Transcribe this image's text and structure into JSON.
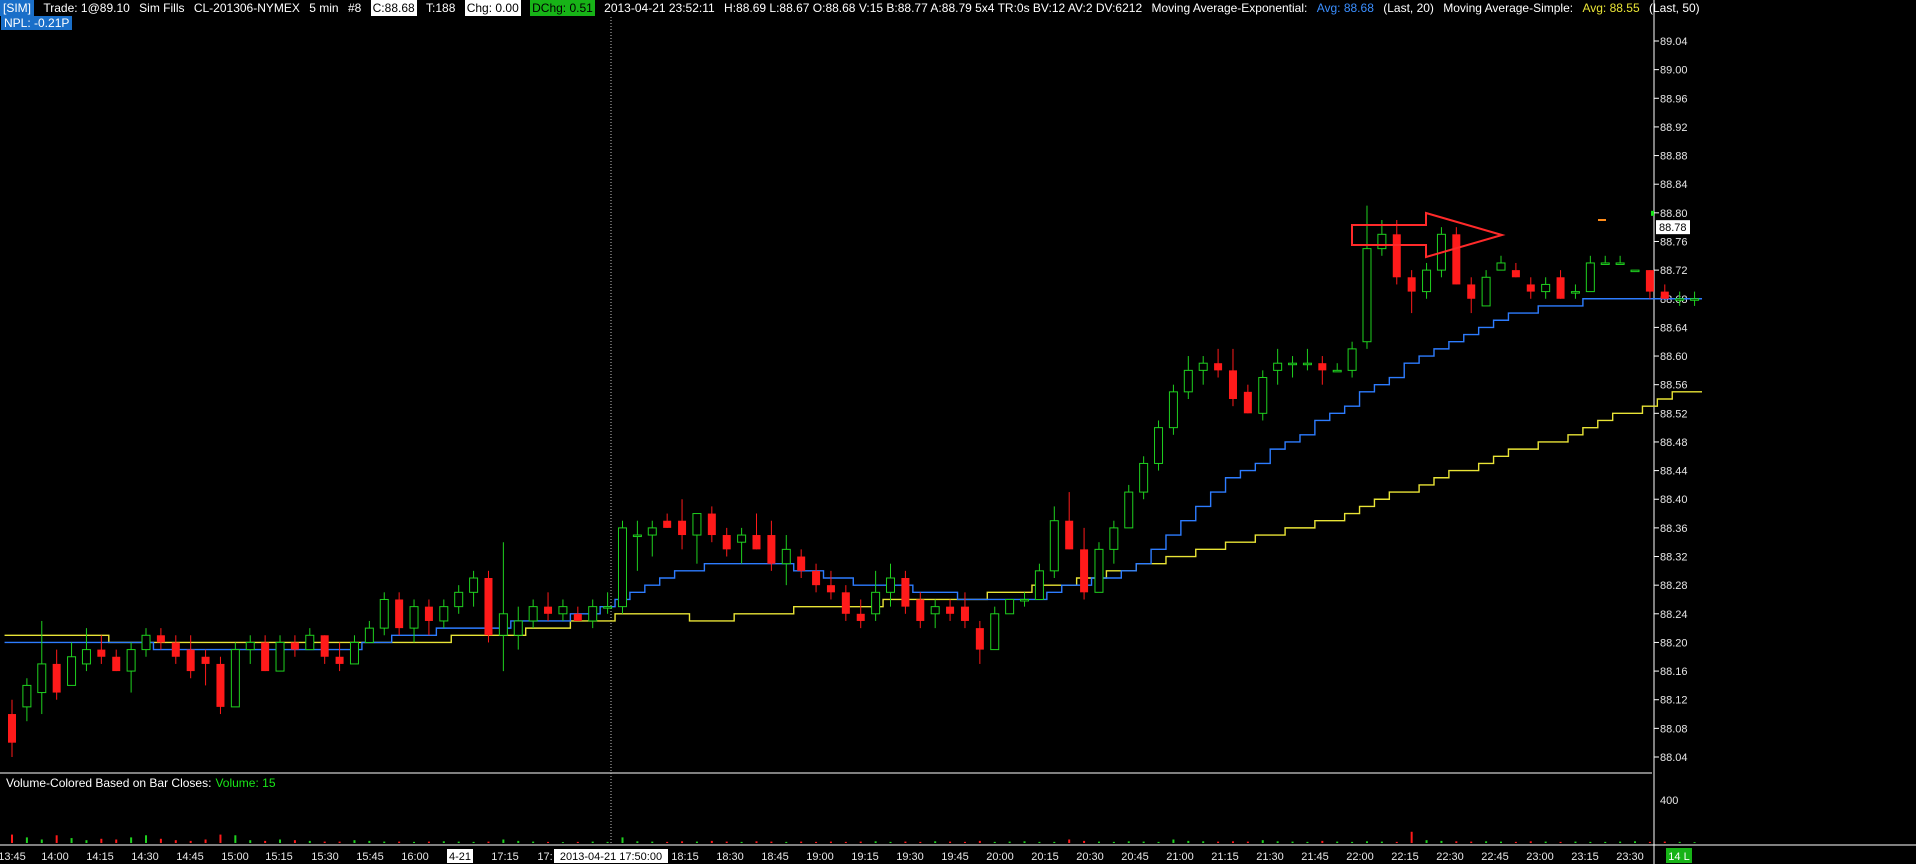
{
  "header": {
    "sim_tag": "[SIM]",
    "trade": "Trade: 1@89.10",
    "sim_fills": "Sim Fills",
    "instrument": "CL-201306-NYMEX",
    "interval": "5 min",
    "hash": "#8",
    "close": "C:88.68",
    "ticks": "T:188",
    "chg": "Chg: 0.00",
    "dchg": "DChg: 0.51",
    "datetime": "2013-04-21 23:52:11",
    "ohlc": "H:88.69 L:88.67 O:88.68 V:15 B:88.77 A:88.79 5x4 TR:0s BV:12 AV:2 DV:6212",
    "ema_label": "Moving Average-Exponential:",
    "ema_avg": "Avg: 88.68",
    "ema_period": "(Last, 20)",
    "sma_label": "Moving Average-Simple:",
    "sma_avg": "Avg: 88.55",
    "sma_period": "(Last, 50)"
  },
  "npl": "NPL: -0.21P",
  "volume_panel": {
    "title": "Volume-Colored Based on Bar Closes:",
    "value": "Volume: 15",
    "axis_label": "400"
  },
  "price_axis": {
    "ticks": [
      "89.04",
      "89.00",
      "88.96",
      "88.92",
      "88.88",
      "88.84",
      "88.80",
      "88.76",
      "88.72",
      "88.68",
      "88.64",
      "88.60",
      "88.56",
      "88.52",
      "88.48",
      "88.44",
      "88.40",
      "88.36",
      "88.32",
      "88.28",
      "88.24",
      "88.20",
      "88.16",
      "88.12",
      "88.08",
      "88.04"
    ],
    "current_price": "88.78"
  },
  "time_axis": {
    "labels": [
      "13:45",
      "14:00",
      "14:15",
      "14:30",
      "14:45",
      "15:00",
      "15:15",
      "15:30",
      "15:45",
      "16:00",
      "4-21",
      "17:15",
      "17:",
      "2013-04-21  17:50:00",
      "18:15",
      "18:30",
      "18:45",
      "19:00",
      "19:15",
      "19:30",
      "19:45",
      "20:00",
      "20:15",
      "20:30",
      "20:45",
      "21:00",
      "21:15",
      "21:30",
      "21:45",
      "22:00",
      "22:15",
      "22:30",
      "22:45",
      "23:00",
      "23:15",
      "23:30"
    ],
    "corner_badge": "14 L"
  },
  "colors": {
    "up": "#1fd11f",
    "down": "#ff1a1a",
    "ema": "#2d7cff",
    "sma": "#e9e436",
    "annotation": "#ff2a2a"
  },
  "chart_data": {
    "type": "candlestick",
    "y_range": [
      88.0,
      89.08
    ],
    "bars": [
      {
        "o": 88.1,
        "h": 88.12,
        "l": 88.04,
        "c": 88.06
      },
      {
        "o": 88.11,
        "h": 88.15,
        "l": 88.09,
        "c": 88.14
      },
      {
        "o": 88.13,
        "h": 88.23,
        "l": 88.1,
        "c": 88.17
      },
      {
        "o": 88.17,
        "h": 88.19,
        "l": 88.12,
        "c": 88.13
      },
      {
        "o": 88.14,
        "h": 88.2,
        "l": 88.14,
        "c": 88.18
      },
      {
        "o": 88.17,
        "h": 88.22,
        "l": 88.16,
        "c": 88.19
      },
      {
        "o": 88.19,
        "h": 88.21,
        "l": 88.17,
        "c": 88.18
      },
      {
        "o": 88.18,
        "h": 88.19,
        "l": 88.16,
        "c": 88.16
      },
      {
        "o": 88.16,
        "h": 88.2,
        "l": 88.13,
        "c": 88.19
      },
      {
        "o": 88.19,
        "h": 88.22,
        "l": 88.18,
        "c": 88.21
      },
      {
        "o": 88.21,
        "h": 88.22,
        "l": 88.19,
        "c": 88.2
      },
      {
        "o": 88.2,
        "h": 88.21,
        "l": 88.17,
        "c": 88.18
      },
      {
        "o": 88.19,
        "h": 88.21,
        "l": 88.15,
        "c": 88.16
      },
      {
        "o": 88.18,
        "h": 88.19,
        "l": 88.14,
        "c": 88.17
      },
      {
        "o": 88.17,
        "h": 88.18,
        "l": 88.1,
        "c": 88.11
      },
      {
        "o": 88.11,
        "h": 88.2,
        "l": 88.11,
        "c": 88.19
      },
      {
        "o": 88.19,
        "h": 88.21,
        "l": 88.17,
        "c": 88.2
      },
      {
        "o": 88.2,
        "h": 88.21,
        "l": 88.16,
        "c": 88.16
      },
      {
        "o": 88.16,
        "h": 88.21,
        "l": 88.16,
        "c": 88.2
      },
      {
        "o": 88.2,
        "h": 88.21,
        "l": 88.18,
        "c": 88.19
      },
      {
        "o": 88.19,
        "h": 88.22,
        "l": 88.19,
        "c": 88.21
      },
      {
        "o": 88.21,
        "h": 88.21,
        "l": 88.17,
        "c": 88.18
      },
      {
        "o": 88.18,
        "h": 88.2,
        "l": 88.16,
        "c": 88.17
      },
      {
        "o": 88.17,
        "h": 88.21,
        "l": 88.17,
        "c": 88.2
      },
      {
        "o": 88.2,
        "h": 88.23,
        "l": 88.2,
        "c": 88.22
      },
      {
        "o": 88.22,
        "h": 88.27,
        "l": 88.21,
        "c": 88.26
      },
      {
        "o": 88.26,
        "h": 88.27,
        "l": 88.21,
        "c": 88.22
      },
      {
        "o": 88.22,
        "h": 88.26,
        "l": 88.2,
        "c": 88.25
      },
      {
        "o": 88.25,
        "h": 88.26,
        "l": 88.21,
        "c": 88.23
      },
      {
        "o": 88.23,
        "h": 88.26,
        "l": 88.22,
        "c": 88.25
      },
      {
        "o": 88.25,
        "h": 88.28,
        "l": 88.24,
        "c": 88.27
      },
      {
        "o": 88.27,
        "h": 88.3,
        "l": 88.25,
        "c": 88.29
      },
      {
        "o": 88.29,
        "h": 88.3,
        "l": 88.2,
        "c": 88.21
      },
      {
        "o": 88.21,
        "h": 88.34,
        "l": 88.16,
        "c": 88.24
      },
      {
        "o": 88.21,
        "h": 88.25,
        "l": 88.19,
        "c": 88.23
      },
      {
        "o": 88.23,
        "h": 88.26,
        "l": 88.22,
        "c": 88.25
      },
      {
        "o": 88.25,
        "h": 88.27,
        "l": 88.23,
        "c": 88.24
      },
      {
        "o": 88.24,
        "h": 88.26,
        "l": 88.23,
        "c": 88.25
      },
      {
        "o": 88.24,
        "h": 88.25,
        "l": 88.23,
        "c": 88.23
      },
      {
        "o": 88.23,
        "h": 88.26,
        "l": 88.22,
        "c": 88.25
      },
      {
        "o": 88.25,
        "h": 88.27,
        "l": 88.24,
        "c": 88.25
      },
      {
        "o": 88.25,
        "h": 88.37,
        "l": 88.24,
        "c": 88.36
      },
      {
        "o": 88.35,
        "h": 88.37,
        "l": 88.3,
        "c": 88.35
      },
      {
        "o": 88.35,
        "h": 88.37,
        "l": 88.32,
        "c": 88.36
      },
      {
        "o": 88.37,
        "h": 88.38,
        "l": 88.36,
        "c": 88.36
      },
      {
        "o": 88.37,
        "h": 88.4,
        "l": 88.33,
        "c": 88.35
      },
      {
        "o": 88.35,
        "h": 88.38,
        "l": 88.31,
        "c": 88.38
      },
      {
        "o": 88.38,
        "h": 88.39,
        "l": 88.34,
        "c": 88.35
      },
      {
        "o": 88.35,
        "h": 88.36,
        "l": 88.32,
        "c": 88.33
      },
      {
        "o": 88.34,
        "h": 88.36,
        "l": 88.31,
        "c": 88.35
      },
      {
        "o": 88.35,
        "h": 88.38,
        "l": 88.33,
        "c": 88.33
      },
      {
        "o": 88.35,
        "h": 88.37,
        "l": 88.3,
        "c": 88.31
      },
      {
        "o": 88.31,
        "h": 88.35,
        "l": 88.28,
        "c": 88.33
      },
      {
        "o": 88.32,
        "h": 88.33,
        "l": 88.29,
        "c": 88.3
      },
      {
        "o": 88.3,
        "h": 88.31,
        "l": 88.27,
        "c": 88.28
      },
      {
        "o": 88.28,
        "h": 88.3,
        "l": 88.26,
        "c": 88.27
      },
      {
        "o": 88.27,
        "h": 88.28,
        "l": 88.23,
        "c": 88.24
      },
      {
        "o": 88.24,
        "h": 88.26,
        "l": 88.22,
        "c": 88.23
      },
      {
        "o": 88.24,
        "h": 88.3,
        "l": 88.23,
        "c": 88.27
      },
      {
        "o": 88.27,
        "h": 88.31,
        "l": 88.25,
        "c": 88.29
      },
      {
        "o": 88.29,
        "h": 88.3,
        "l": 88.24,
        "c": 88.25
      },
      {
        "o": 88.26,
        "h": 88.27,
        "l": 88.22,
        "c": 88.23
      },
      {
        "o": 88.24,
        "h": 88.26,
        "l": 88.22,
        "c": 88.25
      },
      {
        "o": 88.25,
        "h": 88.26,
        "l": 88.23,
        "c": 88.24
      },
      {
        "o": 88.25,
        "h": 88.27,
        "l": 88.22,
        "c": 88.23
      },
      {
        "o": 88.22,
        "h": 88.23,
        "l": 88.17,
        "c": 88.19
      },
      {
        "o": 88.19,
        "h": 88.25,
        "l": 88.19,
        "c": 88.24
      },
      {
        "o": 88.24,
        "h": 88.26,
        "l": 88.24,
        "c": 88.26
      },
      {
        "o": 88.26,
        "h": 88.27,
        "l": 88.25,
        "c": 88.26
      },
      {
        "o": 88.26,
        "h": 88.31,
        "l": 88.26,
        "c": 88.3
      },
      {
        "o": 88.3,
        "h": 88.39,
        "l": 88.29,
        "c": 88.37
      },
      {
        "o": 88.37,
        "h": 88.41,
        "l": 88.33,
        "c": 88.33
      },
      {
        "o": 88.33,
        "h": 88.36,
        "l": 88.26,
        "c": 88.27
      },
      {
        "o": 88.27,
        "h": 88.34,
        "l": 88.27,
        "c": 88.33
      },
      {
        "o": 88.33,
        "h": 88.37,
        "l": 88.31,
        "c": 88.36
      },
      {
        "o": 88.36,
        "h": 88.42,
        "l": 88.36,
        "c": 88.41
      },
      {
        "o": 88.41,
        "h": 88.46,
        "l": 88.4,
        "c": 88.45
      },
      {
        "o": 88.45,
        "h": 88.51,
        "l": 88.44,
        "c": 88.5
      },
      {
        "o": 88.5,
        "h": 88.56,
        "l": 88.49,
        "c": 88.55
      },
      {
        "o": 88.55,
        "h": 88.6,
        "l": 88.54,
        "c": 88.58
      },
      {
        "o": 88.58,
        "h": 88.6,
        "l": 88.56,
        "c": 88.59
      },
      {
        "o": 88.59,
        "h": 88.61,
        "l": 88.57,
        "c": 88.58
      },
      {
        "o": 88.58,
        "h": 88.61,
        "l": 88.53,
        "c": 88.54
      },
      {
        "o": 88.55,
        "h": 88.56,
        "l": 88.52,
        "c": 88.52
      },
      {
        "o": 88.52,
        "h": 88.58,
        "l": 88.51,
        "c": 88.57
      },
      {
        "o": 88.58,
        "h": 88.61,
        "l": 88.56,
        "c": 88.59
      },
      {
        "o": 88.59,
        "h": 88.6,
        "l": 88.57,
        "c": 88.59
      },
      {
        "o": 88.59,
        "h": 88.61,
        "l": 88.58,
        "c": 88.59
      },
      {
        "o": 88.59,
        "h": 88.6,
        "l": 88.56,
        "c": 88.58
      },
      {
        "o": 88.58,
        "h": 88.59,
        "l": 88.58,
        "c": 88.58
      },
      {
        "o": 88.58,
        "h": 88.62,
        "l": 88.57,
        "c": 88.61
      },
      {
        "o": 88.62,
        "h": 88.81,
        "l": 88.61,
        "c": 88.75
      },
      {
        "o": 88.75,
        "h": 88.79,
        "l": 88.74,
        "c": 88.77
      },
      {
        "o": 88.77,
        "h": 88.79,
        "l": 88.7,
        "c": 88.71
      },
      {
        "o": 88.71,
        "h": 88.72,
        "l": 88.66,
        "c": 88.69
      },
      {
        "o": 88.69,
        "h": 88.73,
        "l": 88.68,
        "c": 88.72
      },
      {
        "o": 88.72,
        "h": 88.78,
        "l": 88.71,
        "c": 88.77
      },
      {
        "o": 88.77,
        "h": 88.78,
        "l": 88.7,
        "c": 88.7
      },
      {
        "o": 88.7,
        "h": 88.71,
        "l": 88.66,
        "c": 88.68
      },
      {
        "o": 88.67,
        "h": 88.72,
        "l": 88.67,
        "c": 88.71
      },
      {
        "o": 88.72,
        "h": 88.74,
        "l": 88.72,
        "c": 88.73
      },
      {
        "o": 88.72,
        "h": 88.73,
        "l": 88.71,
        "c": 88.71
      },
      {
        "o": 88.7,
        "h": 88.71,
        "l": 88.68,
        "c": 88.69
      },
      {
        "o": 88.69,
        "h": 88.71,
        "l": 88.68,
        "c": 88.7
      },
      {
        "o": 88.71,
        "h": 88.72,
        "l": 88.68,
        "c": 88.68
      },
      {
        "o": 88.69,
        "h": 88.7,
        "l": 88.68,
        "c": 88.69
      },
      {
        "o": 88.69,
        "h": 88.74,
        "l": 88.69,
        "c": 88.73
      },
      {
        "o": 88.73,
        "h": 88.74,
        "l": 88.73,
        "c": 88.73
      },
      {
        "o": 88.73,
        "h": 88.74,
        "l": 88.73,
        "c": 88.73
      },
      {
        "o": 88.72,
        "h": 88.72,
        "l": 88.72,
        "c": 88.72
      },
      {
        "o": 88.72,
        "h": 88.72,
        "l": 88.68,
        "c": 88.69
      },
      {
        "o": 88.69,
        "h": 88.7,
        "l": 88.68,
        "c": 88.68
      },
      {
        "o": 88.68,
        "h": 88.69,
        "l": 88.67,
        "c": 88.68
      },
      {
        "o": 88.68,
        "h": 88.69,
        "l": 88.67,
        "c": 88.68
      }
    ],
    "ema_20": [
      88.2,
      88.2,
      88.2,
      88.2,
      88.2,
      88.2,
      88.2,
      88.2,
      88.2,
      88.2,
      88.19,
      88.19,
      88.19,
      88.19,
      88.19,
      88.19,
      88.19,
      88.19,
      88.19,
      88.19,
      88.19,
      88.19,
      88.19,
      88.19,
      88.2,
      88.2,
      88.21,
      88.21,
      88.21,
      88.22,
      88.22,
      88.22,
      88.22,
      88.22,
      88.23,
      88.23,
      88.23,
      88.23,
      88.24,
      88.24,
      88.25,
      88.26,
      88.27,
      88.28,
      88.29,
      88.3,
      88.3,
      88.31,
      88.31,
      88.31,
      88.31,
      88.31,
      88.31,
      88.3,
      88.3,
      88.29,
      88.29,
      88.28,
      88.28,
      88.28,
      88.28,
      88.27,
      88.27,
      88.27,
      88.26,
      88.26,
      88.26,
      88.26,
      88.26,
      88.26,
      88.27,
      88.28,
      88.28,
      88.29,
      88.29,
      88.3,
      88.31,
      88.33,
      88.35,
      88.37,
      88.39,
      88.41,
      88.43,
      88.44,
      88.45,
      88.47,
      88.48,
      88.49,
      88.51,
      88.52,
      88.53,
      88.55,
      88.56,
      88.57,
      88.59,
      88.6,
      88.61,
      88.62,
      88.63,
      88.64,
      88.65,
      88.66,
      88.66,
      88.67,
      88.67,
      88.67,
      88.68,
      88.68,
      88.68,
      88.68,
      88.68,
      88.68,
      88.68,
      88.68
    ],
    "sma_50": [
      88.21,
      88.21,
      88.21,
      88.21,
      88.21,
      88.21,
      88.21,
      88.2,
      88.2,
      88.2,
      88.2,
      88.2,
      88.2,
      88.2,
      88.2,
      88.2,
      88.2,
      88.2,
      88.2,
      88.2,
      88.2,
      88.2,
      88.2,
      88.2,
      88.2,
      88.2,
      88.2,
      88.2,
      88.2,
      88.2,
      88.21,
      88.21,
      88.21,
      88.21,
      88.21,
      88.22,
      88.22,
      88.22,
      88.23,
      88.23,
      88.23,
      88.24,
      88.24,
      88.24,
      88.24,
      88.24,
      88.23,
      88.23,
      88.23,
      88.24,
      88.24,
      88.24,
      88.24,
      88.25,
      88.25,
      88.25,
      88.25,
      88.25,
      88.25,
      88.26,
      88.26,
      88.26,
      88.26,
      88.26,
      88.26,
      88.26,
      88.27,
      88.27,
      88.27,
      88.28,
      88.28,
      88.28,
      88.29,
      88.29,
      88.3,
      88.3,
      88.31,
      88.31,
      88.32,
      88.32,
      88.33,
      88.33,
      88.34,
      88.34,
      88.35,
      88.35,
      88.36,
      88.36,
      88.37,
      88.37,
      88.38,
      88.39,
      88.4,
      88.41,
      88.41,
      88.42,
      88.43,
      88.44,
      88.44,
      88.45,
      88.46,
      88.47,
      88.47,
      88.48,
      88.48,
      88.49,
      88.5,
      88.51,
      88.52,
      88.52,
      88.53,
      88.54,
      88.55,
      88.55
    ],
    "volume": [
      60,
      40,
      25,
      55,
      35,
      20,
      30,
      25,
      40,
      55,
      30,
      20,
      15,
      25,
      60,
      55,
      20,
      15,
      25,
      20,
      15,
      10,
      10,
      20,
      15,
      10,
      10,
      8,
      10,
      12,
      10,
      8,
      10,
      25,
      15,
      10,
      8,
      6,
      8,
      10,
      8,
      40,
      12,
      10,
      8,
      12,
      10,
      15,
      10,
      8,
      12,
      10,
      8,
      10,
      8,
      10,
      8,
      10,
      12,
      8,
      10,
      8,
      12,
      10,
      8,
      15,
      8,
      10,
      12,
      8,
      8,
      25,
      15,
      10,
      8,
      12,
      10,
      8,
      25,
      15,
      12,
      10,
      12,
      10,
      20,
      12,
      10,
      8,
      15,
      10,
      8,
      12,
      10,
      8,
      80,
      20,
      15,
      12,
      10,
      12,
      10,
      8,
      12,
      10,
      8,
      10,
      8,
      8,
      10,
      12,
      8,
      10,
      8,
      6
    ],
    "volume_max": 520
  }
}
